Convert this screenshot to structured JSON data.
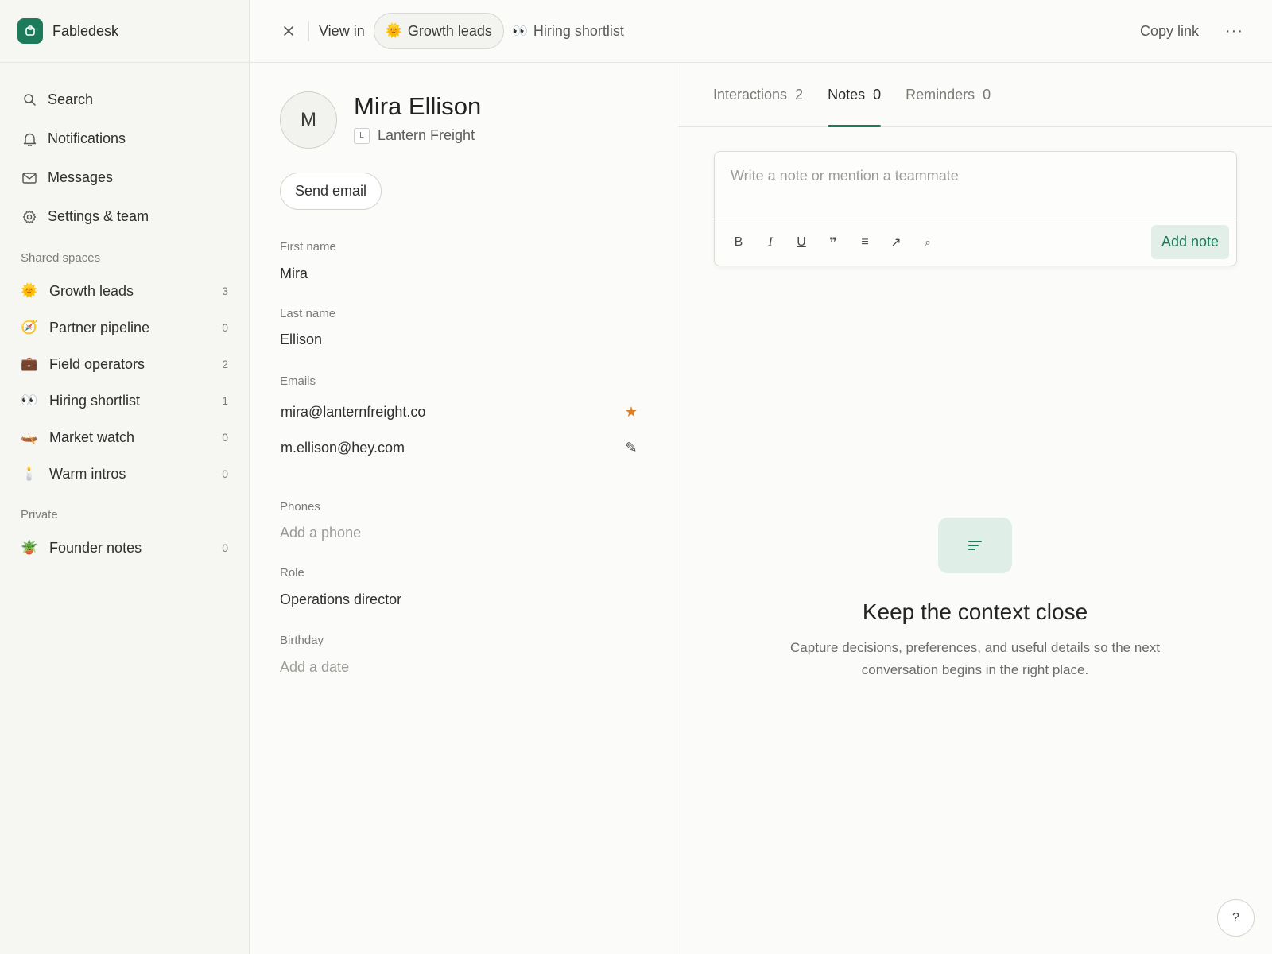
{
  "app": {
    "name": "Fabledesk",
    "logo_icon": "app-logo-icon",
    "accent": "#1d7a5a"
  },
  "sidebar": {
    "nav": [
      {
        "label": "Search",
        "icon": "search-icon"
      },
      {
        "label": "Notifications",
        "icon": "bell-icon"
      },
      {
        "label": "Messages",
        "icon": "mail-icon"
      },
      {
        "label": "Settings & team",
        "icon": "gear-icon"
      }
    ],
    "shared_label": "Shared spaces",
    "shared": [
      {
        "emoji": "🌞",
        "label": "Growth leads",
        "count": "3"
      },
      {
        "emoji": "🧭",
        "label": "Partner pipeline",
        "count": "0"
      },
      {
        "emoji": "💼",
        "label": "Field operators",
        "count": "2"
      },
      {
        "emoji": "👀",
        "label": "Hiring shortlist",
        "count": "1"
      },
      {
        "emoji": "🛶",
        "label": "Market watch",
        "count": "0"
      },
      {
        "emoji": "🕯️",
        "label": "Warm intros",
        "count": "0"
      }
    ],
    "private_label": "Private",
    "private": [
      {
        "emoji": "🪴",
        "label": "Founder notes",
        "count": "0"
      }
    ]
  },
  "topbar": {
    "view_in": "View in",
    "active_view": {
      "emoji": "🌞",
      "label": "Growth leads"
    },
    "other_view": {
      "emoji": "👀",
      "label": "Hiring shortlist"
    },
    "copy_link": "Copy link",
    "more": "···"
  },
  "person": {
    "initial": "M",
    "name": "Mira Ellison",
    "company_initial": "L",
    "company": "Lantern Freight",
    "send_email": "Send email",
    "fields": {
      "first_name_label": "First name",
      "first_name": "Mira",
      "last_name_label": "Last name",
      "last_name": "Ellison",
      "emails_label": "Emails",
      "emails": [
        {
          "value": "mira@lanternfreight.co",
          "action_icon": "star-icon",
          "action_color": "#d9822b"
        },
        {
          "value": "m.ellison@hey.com",
          "action_icon": "pencil-icon"
        }
      ],
      "phones_label": "Phones",
      "phones_placeholder": "Add a phone",
      "role_label": "Role",
      "role": "Operations director",
      "birthday_label": "Birthday",
      "birthday_placeholder": "Add a date"
    }
  },
  "tabs": [
    {
      "label": "Interactions",
      "count": "2",
      "active": false
    },
    {
      "label": "Notes",
      "count": "0",
      "active": true
    },
    {
      "label": "Reminders",
      "count": "0",
      "active": false
    }
  ],
  "composer": {
    "placeholder": "Write a note or mention a teammate",
    "tools": [
      "B",
      "I",
      "U",
      "❞",
      "≡",
      "↗",
      "⌕"
    ],
    "submit": "Add note"
  },
  "empty_state": {
    "icon": "notes-lines-icon",
    "title": "Keep the context close",
    "body": "Capture decisions, preferences, and useful details so the next conversation begins in the right place."
  },
  "help": "?"
}
